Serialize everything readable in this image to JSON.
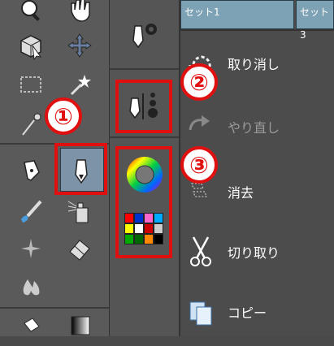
{
  "tabs": [
    "セット1",
    "セット3"
  ],
  "commands": {
    "undo": "取り消し",
    "redo": "やり直し",
    "erase": "消去",
    "cut": "切り取り",
    "copy": "コピー"
  },
  "callouts": [
    "①",
    "②",
    "③"
  ],
  "palette_colors": [
    "#ff0000",
    "#0033cc",
    "#ff66cc",
    "#00aaff",
    "#ffff00",
    "#ffffff",
    "#cc0000",
    "#cccccc",
    "#00aa00",
    "#006600",
    "#ff8800",
    "#000000"
  ],
  "highlight_color": "#e01010"
}
